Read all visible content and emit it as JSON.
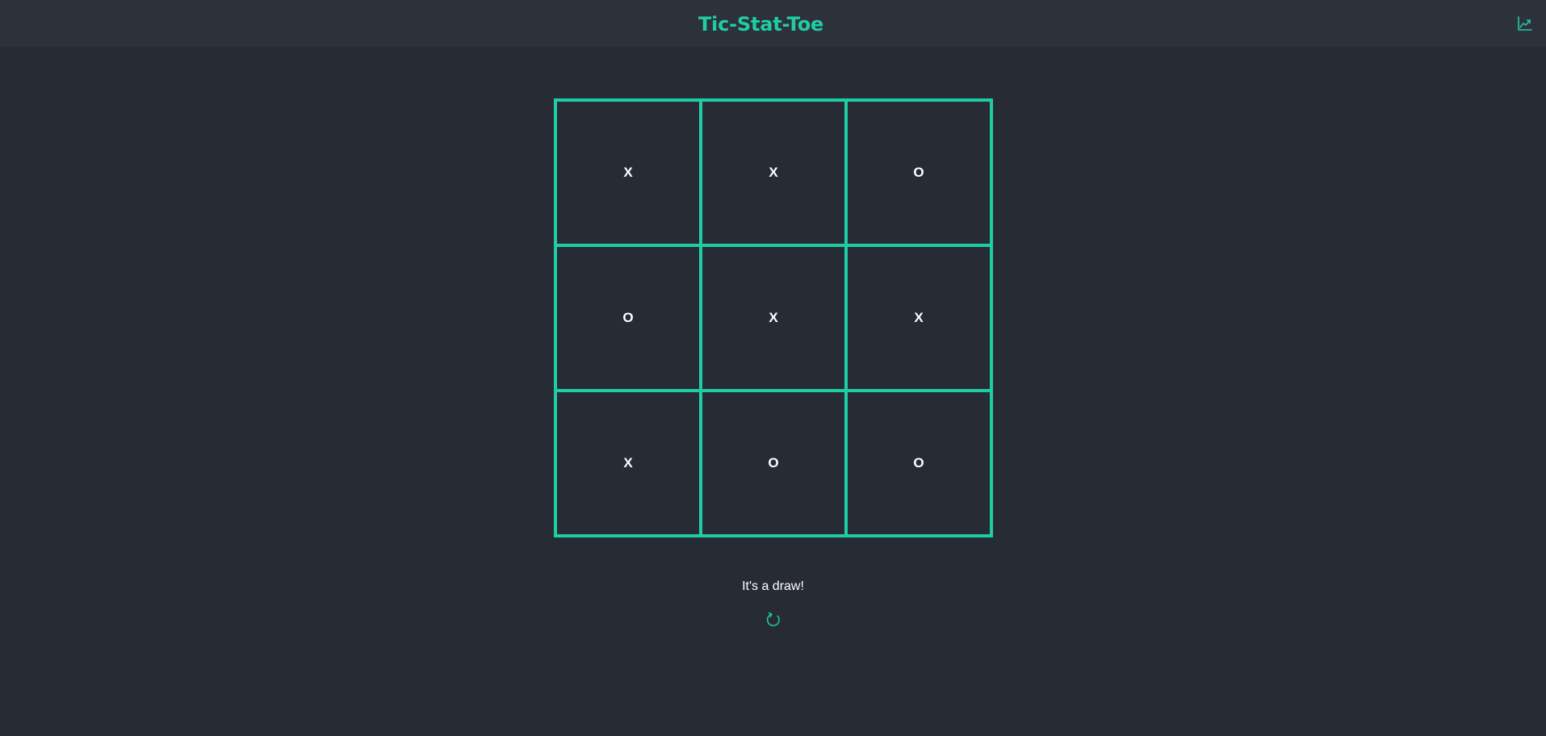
{
  "header": {
    "title": "Tic-Stat-Toe",
    "stats_icon": "chart-line-icon"
  },
  "board": {
    "cells": [
      "X",
      "X",
      "O",
      "O",
      "X",
      "X",
      "X",
      "O",
      "O"
    ]
  },
  "status": {
    "message": "It's a draw!"
  },
  "reset": {
    "icon": "refresh-icon"
  },
  "colors": {
    "accent": "#1fcda5",
    "background": "#272b34",
    "header_background": "#2d313a",
    "text": "#ffffff"
  }
}
